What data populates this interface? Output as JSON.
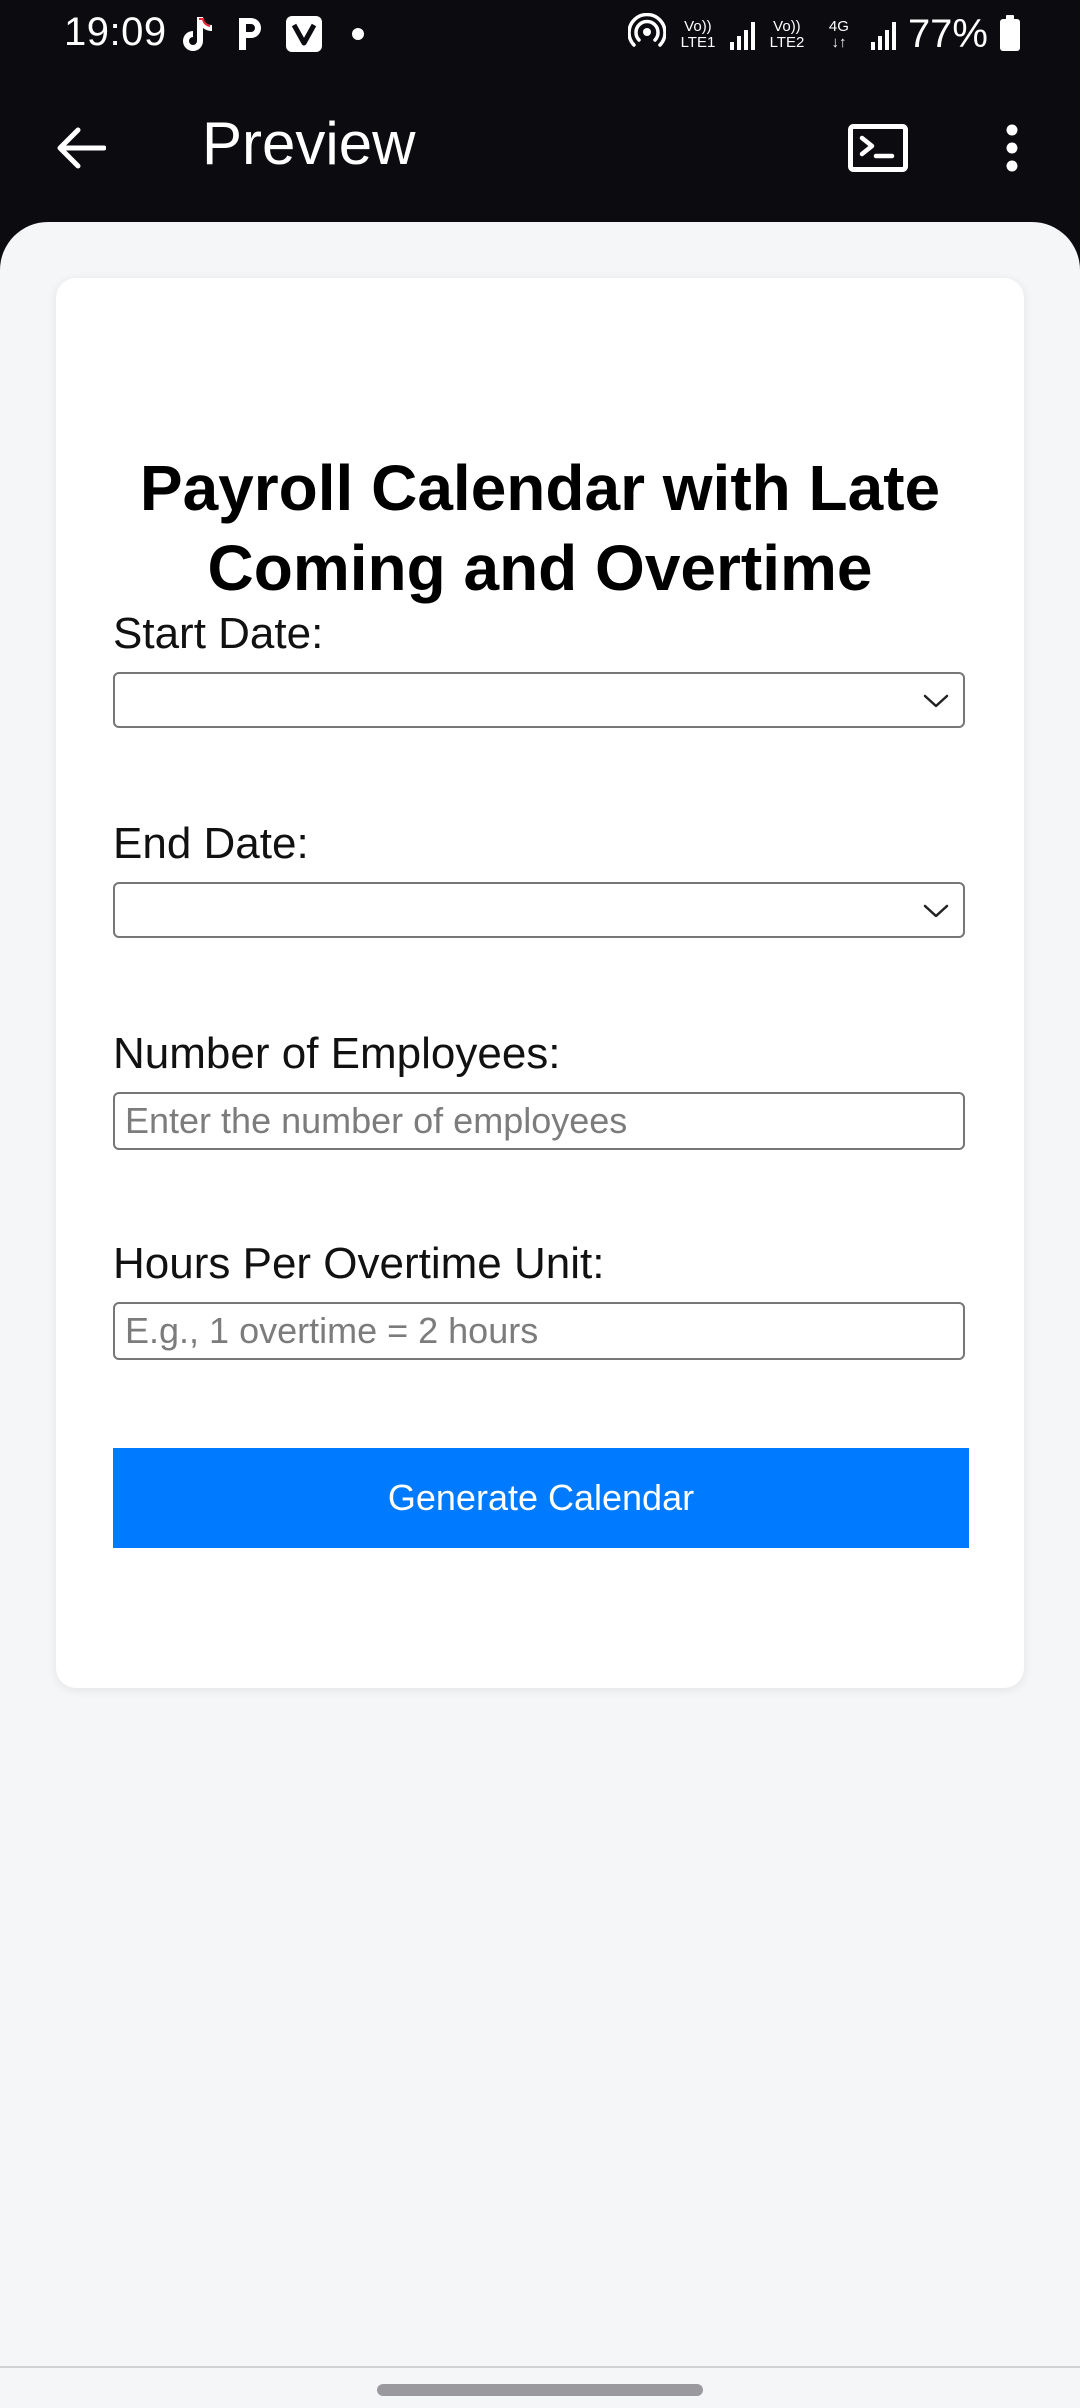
{
  "status_bar": {
    "time": "19:09",
    "notification_icons": [
      "tiktok-icon",
      "p-icon",
      "v-icon",
      "dot-icon"
    ],
    "network": [
      {
        "top": "Vo))",
        "bottom": "LTE1"
      },
      {
        "top": "Vo))",
        "bottom": "LTE2"
      },
      {
        "top": "4G",
        "bottom": "↓↑"
      }
    ],
    "battery": "77%"
  },
  "app_bar": {
    "title": "Preview",
    "icons": [
      "back-arrow-icon",
      "terminal-icon",
      "more-vert-icon"
    ]
  },
  "form": {
    "title": "Payroll Calendar with Late Coming and Overtime",
    "start_date": {
      "label": "Start Date:",
      "value": ""
    },
    "end_date": {
      "label": "End Date:",
      "value": ""
    },
    "employees": {
      "label": "Number of Employees:",
      "placeholder": "Enter the number of employees"
    },
    "overtime": {
      "label": "Hours Per Overtime Unit:",
      "placeholder": "E.g., 1 overtime = 2 hours"
    },
    "submit_label": "Generate Calendar"
  },
  "colors": {
    "app_bar_bg": "#0c0c10",
    "content_bg": "#f5f6f8",
    "card_bg": "#ffffff",
    "button_bg": "#007bff",
    "button_text": "#ffffff"
  }
}
